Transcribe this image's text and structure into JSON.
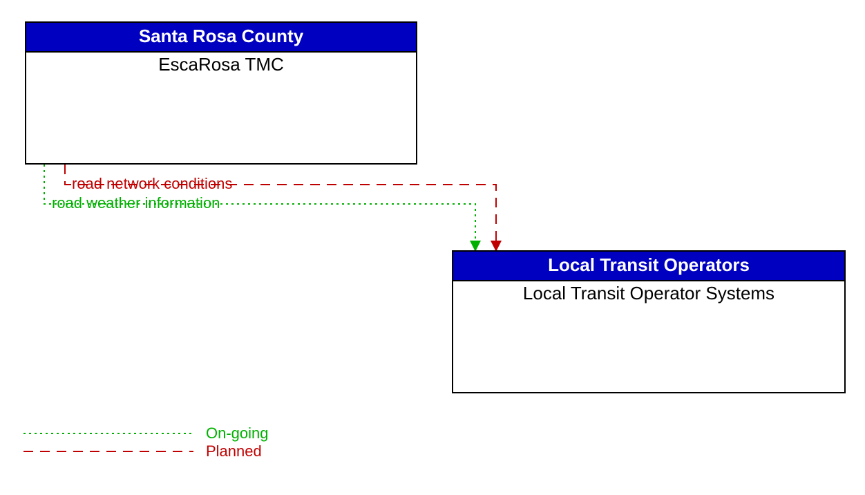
{
  "boxes": {
    "tmc": {
      "header": "Santa Rosa County",
      "body": "EscaRosa TMC"
    },
    "transit": {
      "header": "Local Transit Operators",
      "body": "Local Transit Operator Systems"
    }
  },
  "flows": {
    "road_network_conditions": "road network conditions",
    "road_weather_information": "road weather information"
  },
  "legend": {
    "ongoing": "On-going",
    "planned": "Planned"
  },
  "colors": {
    "header_bg": "#0000c0",
    "planned": "#c00000",
    "ongoing": "#00b000"
  }
}
